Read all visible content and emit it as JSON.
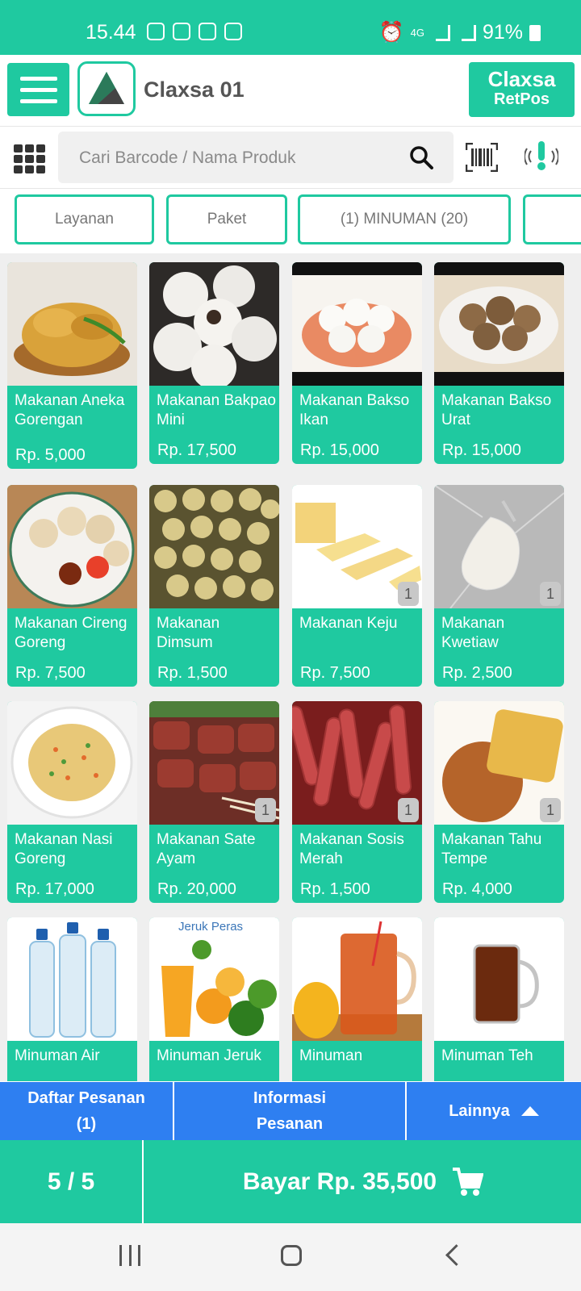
{
  "status_bar": {
    "time": "15.44",
    "network": "4G",
    "battery": "91%"
  },
  "app_bar": {
    "store_name": "Claxsa 01",
    "brand_line1": "Claxsa",
    "brand_line2": "RetPos"
  },
  "search": {
    "placeholder": "Cari Barcode / Nama Produk"
  },
  "categories": [
    "Layanan",
    "Paket",
    "(1) MINUMAN (20)",
    ""
  ],
  "products": [
    {
      "name": "Makanan Aneka Gorengan",
      "price": "Rp. 5,000",
      "badge": "",
      "image": "fried-fritters"
    },
    {
      "name": "Makanan Bakpao Mini",
      "price": "Rp. 17,500",
      "badge": "",
      "image": "steamed-buns"
    },
    {
      "name": "Makanan Bakso Ikan",
      "price": "Rp. 15,000",
      "badge": "",
      "image": "fish-balls"
    },
    {
      "name": "Makanan Bakso Urat",
      "price": "Rp. 15,000",
      "badge": "",
      "image": "meatballs"
    },
    {
      "name": "Makanan Cireng Goreng",
      "price": "Rp. 7,500",
      "badge": "",
      "image": "cireng"
    },
    {
      "name": "Makanan Dimsum",
      "price": "Rp. 1,500",
      "badge": "",
      "image": "dimsum"
    },
    {
      "name": "Makanan Keju",
      "price": "Rp. 7,500",
      "badge": "1",
      "image": "cheese"
    },
    {
      "name": "Makanan Kwetiaw",
      "price": "Rp. 2,500",
      "badge": "1",
      "image": "kwetiaw"
    },
    {
      "name": "Makanan Nasi Goreng",
      "price": "Rp. 17,000",
      "badge": "",
      "image": "fried-rice"
    },
    {
      "name": "Makanan Sate Ayam",
      "price": "Rp. 20,000",
      "badge": "1",
      "image": "satay"
    },
    {
      "name": "Makanan Sosis Merah",
      "price": "Rp. 1,500",
      "badge": "1",
      "image": "sausages"
    },
    {
      "name": "Makanan Tahu Tempe",
      "price": "Rp. 4,000",
      "badge": "1",
      "image": "tofu-tempeh"
    },
    {
      "name": "Minuman Air",
      "price": "",
      "badge": "",
      "image": "water-bottles"
    },
    {
      "name": "Minuman Jeruk",
      "price": "",
      "badge": "",
      "image": "orange-juice",
      "image_text": "Jeruk Peras"
    },
    {
      "name": "Minuman",
      "price": "",
      "badge": "",
      "image": "iced-drink"
    },
    {
      "name": "Minuman Teh",
      "price": "",
      "badge": "",
      "image": "tea-mug"
    }
  ],
  "bottom_tabs": {
    "orders": "Daftar Pesanan (1)",
    "info": "Informasi Pesanan",
    "more": "Lainnya"
  },
  "pay_bar": {
    "count": "5 / 5",
    "pay_label": "Bayar Rp. 35,500"
  },
  "colors": {
    "accent": "#1fc9a0",
    "tab_blue": "#2e7ff1"
  }
}
